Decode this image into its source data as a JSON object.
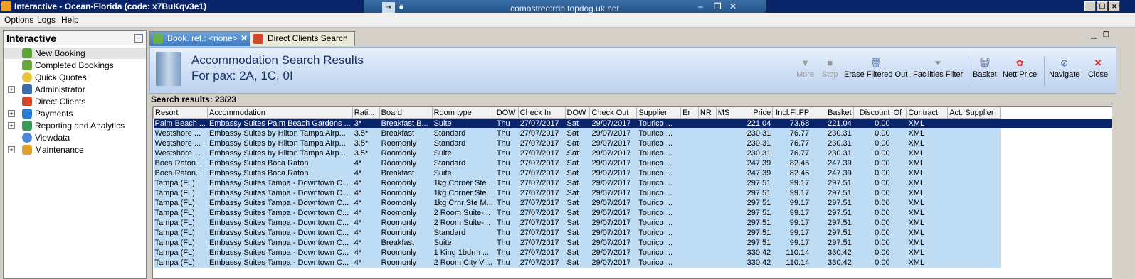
{
  "window": {
    "title": "Interactive - Ocean-Florida (code: x7BuKqv3e1)"
  },
  "rdp": {
    "host": "comostreetrdp.topdog.uk.net"
  },
  "menu": [
    "Options",
    "Logs",
    "Help"
  ],
  "sidebar": {
    "title": "Interactive",
    "items": [
      {
        "label": "New Booking",
        "icon": "palm-tree-icon"
      },
      {
        "label": "Completed Bookings",
        "icon": "palm-tree-icon"
      },
      {
        "label": "Quick Quotes",
        "icon": "clock-icon"
      },
      {
        "label": "Administrator",
        "icon": "admin-icon"
      },
      {
        "label": "Direct Clients",
        "icon": "clients-icon"
      },
      {
        "label": "Payments",
        "icon": "payments-icon"
      },
      {
        "label": "Reporting and Analytics",
        "icon": "reports-icon"
      },
      {
        "label": "Viewdata",
        "icon": "globe-icon"
      },
      {
        "label": "Maintenance",
        "icon": "maintenance-icon"
      }
    ]
  },
  "tabs": [
    {
      "label": "Book. ref.: <none>"
    },
    {
      "label": "Direct Clients Search"
    }
  ],
  "banner": {
    "title": "Accommodation Search Results",
    "subtitle": "For pax: 2A, 1C, 0I"
  },
  "toolbar": {
    "more": "More",
    "stop": "Stop",
    "erase": "Erase Filtered Out",
    "facilities": "Facilities Filter",
    "basket": "Basket",
    "nett": "Nett Price",
    "navigate": "Navigate",
    "close": "Close"
  },
  "results": {
    "count_label": "Search results: 23/23",
    "columns": [
      "Resort",
      "Accommodation",
      "Rati...",
      "Board",
      "Room type",
      "DOW",
      "Check In",
      "DOW",
      "Check Out",
      "Supplier",
      "Er",
      "NR",
      "MS",
      "Price",
      "Incl.Fl.PP",
      "Basket",
      "Discount",
      "Of",
      "Contract",
      "Act. Supplier"
    ],
    "rows": [
      [
        "Palm Beach ...",
        "Embassy Suites Palm Beach Gardens ...",
        "3*",
        "Breakfast B...",
        "Suite",
        "Thu",
        "27/07/2017",
        "Sat",
        "29/07/2017",
        "Tourico ...",
        "",
        "",
        "",
        "221.04",
        "73.68",
        "221.04",
        "0.00",
        "",
        "XML",
        ""
      ],
      [
        "Westshore ...",
        "Embassy Suites by Hilton Tampa Airp...",
        "3.5*",
        "Breakfast",
        "Standard",
        "Thu",
        "27/07/2017",
        "Sat",
        "29/07/2017",
        "Tourico ...",
        "",
        "",
        "",
        "230.31",
        "76.77",
        "230.31",
        "0.00",
        "",
        "XML",
        ""
      ],
      [
        "Westshore ...",
        "Embassy Suites by Hilton Tampa Airp...",
        "3.5*",
        "Roomonly",
        "Standard",
        "Thu",
        "27/07/2017",
        "Sat",
        "29/07/2017",
        "Tourico ...",
        "",
        "",
        "",
        "230.31",
        "76.77",
        "230.31",
        "0.00",
        "",
        "XML",
        ""
      ],
      [
        "Westshore ...",
        "Embassy Suites by Hilton Tampa Airp...",
        "3.5*",
        "Roomonly",
        "Suite",
        "Thu",
        "27/07/2017",
        "Sat",
        "29/07/2017",
        "Tourico ...",
        "",
        "",
        "",
        "230.31",
        "76.77",
        "230.31",
        "0.00",
        "",
        "XML",
        ""
      ],
      [
        "Boca Raton...",
        "Embassy Suites Boca Raton",
        "4*",
        "Roomonly",
        "Standard",
        "Thu",
        "27/07/2017",
        "Sat",
        "29/07/2017",
        "Tourico ...",
        "",
        "",
        "",
        "247.39",
        "82.46",
        "247.39",
        "0.00",
        "",
        "XML",
        ""
      ],
      [
        "Boca Raton...",
        "Embassy Suites Boca Raton",
        "4*",
        "Breakfast",
        "Suite",
        "Thu",
        "27/07/2017",
        "Sat",
        "29/07/2017",
        "Tourico ...",
        "",
        "",
        "",
        "247.39",
        "82.46",
        "247.39",
        "0.00",
        "",
        "XML",
        ""
      ],
      [
        "Tampa (FL)",
        "Embassy Suites Tampa - Downtown C...",
        "4*",
        "Roomonly",
        "1kg Corner Ste...",
        "Thu",
        "27/07/2017",
        "Sat",
        "29/07/2017",
        "Tourico ...",
        "",
        "",
        "",
        "297.51",
        "99.17",
        "297.51",
        "0.00",
        "",
        "XML",
        ""
      ],
      [
        "Tampa (FL)",
        "Embassy Suites Tampa - Downtown C...",
        "4*",
        "Roomonly",
        "1kg Corner Ste...",
        "Thu",
        "27/07/2017",
        "Sat",
        "29/07/2017",
        "Tourico ...",
        "",
        "",
        "",
        "297.51",
        "99.17",
        "297.51",
        "0.00",
        "",
        "XML",
        ""
      ],
      [
        "Tampa (FL)",
        "Embassy Suites Tampa - Downtown C...",
        "4*",
        "Roomonly",
        "1kg Crnr Ste M...",
        "Thu",
        "27/07/2017",
        "Sat",
        "29/07/2017",
        "Tourico ...",
        "",
        "",
        "",
        "297.51",
        "99.17",
        "297.51",
        "0.00",
        "",
        "XML",
        ""
      ],
      [
        "Tampa (FL)",
        "Embassy Suites Tampa - Downtown C...",
        "4*",
        "Roomonly",
        "2 Room Suite-...",
        "Thu",
        "27/07/2017",
        "Sat",
        "29/07/2017",
        "Tourico ...",
        "",
        "",
        "",
        "297.51",
        "99.17",
        "297.51",
        "0.00",
        "",
        "XML",
        ""
      ],
      [
        "Tampa (FL)",
        "Embassy Suites Tampa - Downtown C...",
        "4*",
        "Roomonly",
        "2 Room Suite-...",
        "Thu",
        "27/07/2017",
        "Sat",
        "29/07/2017",
        "Tourico ...",
        "",
        "",
        "",
        "297.51",
        "99.17",
        "297.51",
        "0.00",
        "",
        "XML",
        ""
      ],
      [
        "Tampa (FL)",
        "Embassy Suites Tampa - Downtown C...",
        "4*",
        "Roomonly",
        "Standard",
        "Thu",
        "27/07/2017",
        "Sat",
        "29/07/2017",
        "Tourico ...",
        "",
        "",
        "",
        "297.51",
        "99.17",
        "297.51",
        "0.00",
        "",
        "XML",
        ""
      ],
      [
        "Tampa (FL)",
        "Embassy Suites Tampa - Downtown C...",
        "4*",
        "Breakfast",
        "Suite",
        "Thu",
        "27/07/2017",
        "Sat",
        "29/07/2017",
        "Tourico ...",
        "",
        "",
        "",
        "297.51",
        "99.17",
        "297.51",
        "0.00",
        "",
        "XML",
        ""
      ],
      [
        "Tampa (FL)",
        "Embassy Suites Tampa - Downtown C...",
        "4*",
        "Roomonly",
        "1 King 1bdrm ...",
        "Thu",
        "27/07/2017",
        "Sat",
        "29/07/2017",
        "Tourico ...",
        "",
        "",
        "",
        "330.42",
        "110.14",
        "330.42",
        "0.00",
        "",
        "XML",
        ""
      ],
      [
        "Tampa (FL)",
        "Embassy Suites Tampa - Downtown C...",
        "4*",
        "Roomonly",
        "2 Room City Vi...",
        "Thu",
        "27/07/2017",
        "Sat",
        "29/07/2017",
        "Tourico ...",
        "",
        "",
        "",
        "330.42",
        "110.14",
        "330.42",
        "0.00",
        "",
        "XML",
        ""
      ]
    ]
  }
}
